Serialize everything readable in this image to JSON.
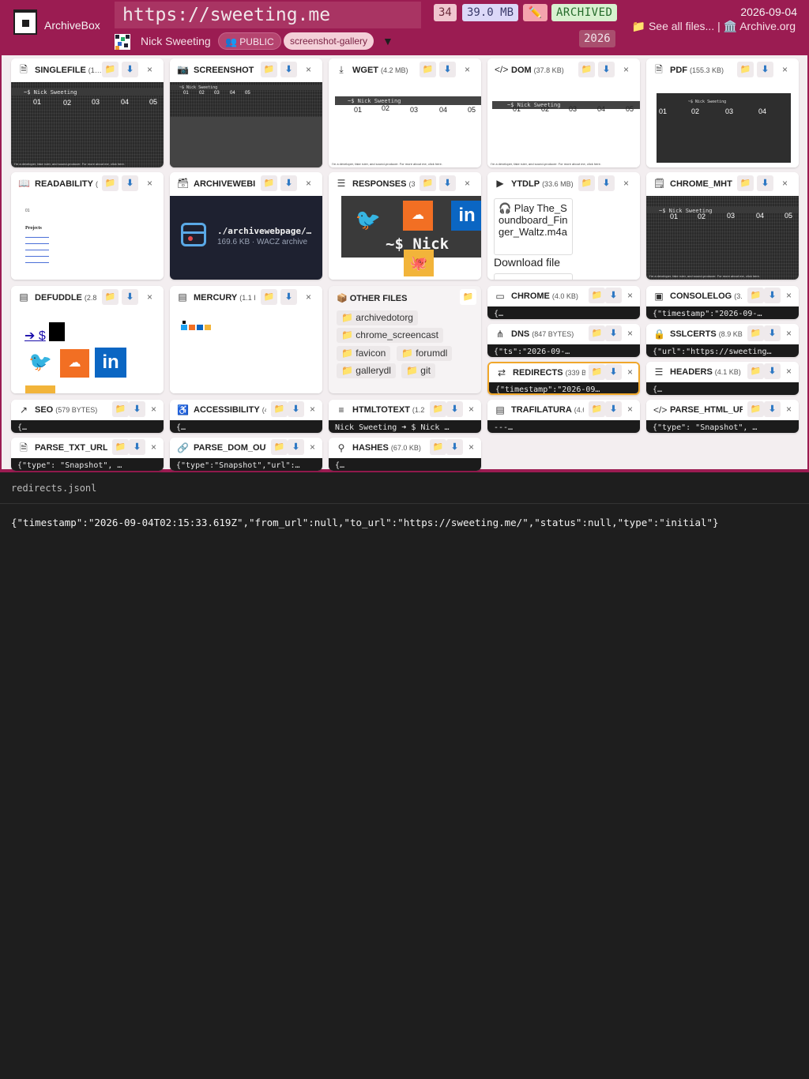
{
  "header": {
    "brand": "ArchiveBox",
    "url": "https://sweeting.me",
    "count": "34",
    "size": "39.0 MB",
    "edit_icon": "✏️",
    "status": "ARCHIVED",
    "year": "2026",
    "author": "Nick Sweeting",
    "visibility": "👥 PUBLIC",
    "tag": "screenshot-gallery",
    "tag_menu": "▼",
    "date": "2026-09-04",
    "see_all": "📁 See all files...",
    "separator": " | ",
    "archive_org": "🏛️ Archive.org",
    "colors": {
      "header_bg": "#9b1c52",
      "accent": "#f0a72a"
    }
  },
  "cards": {
    "singlefile": {
      "title": "SINGLEFILE",
      "size": "(1⁠…"
    },
    "screenshot": {
      "title": "SCREENSHOT"
    },
    "wget": {
      "title": "WGET",
      "size": "(4.2 MB)"
    },
    "dom": {
      "title": "DOM",
      "size": "(37.8 KB)"
    },
    "pdf": {
      "title": "PDF",
      "size": "(155.3 KB)"
    },
    "readability": {
      "title": "READABILITY",
      "size": "("
    },
    "archivewebpage": {
      "title": "ARCHIVEWEBI",
      "file": "./archivewebpage/…",
      "meta": "169.6 KB · WACZ archive"
    },
    "responses": {
      "title": "RESPONSES",
      "size": "(3"
    },
    "ytdlp": {
      "title": "YTDLP",
      "size": "(33.6 MB)",
      "play": "🎧 Play The_Soundboard_Finger_Waltz.m4a",
      "download": "Download file"
    },
    "chrome_mht": {
      "title": "CHROME_MHT"
    },
    "defuddle": {
      "title": "DEFUDDLE",
      "size": "(2.8"
    },
    "mercury": {
      "title": "MERCURY",
      "size": "(1.1 I"
    },
    "other_files": {
      "title": "📦 OTHER FILES",
      "files": [
        "📁 archivedotorg",
        "📁 chrome_screencast",
        "📁 favicon",
        "📁 forumdl",
        "📁 gallerydl",
        "📁 git"
      ]
    },
    "chrome": {
      "title": "CHROME",
      "size": "(4.0 KB)",
      "preview": "{…"
    },
    "consolelog": {
      "title": "CONSOLELOG",
      "size": "(3.",
      "preview": "{\"timestamp\":\"2026-09-…"
    },
    "dns": {
      "title": "DNS",
      "size": "(847 BYTES)",
      "preview": "{\"ts\":\"2026-09-…"
    },
    "sslcerts": {
      "title": "SSLCERTS",
      "size": "(8.9 KB)",
      "preview": "{\"url\":\"https://sweeting…"
    },
    "redirects": {
      "title": "REDIRECTS",
      "size": "(339 B",
      "preview": "{\"timestamp\":\"2026-09…"
    },
    "headers": {
      "title": "HEADERS",
      "size": "(4.1 KB)",
      "preview": "{…"
    },
    "seo": {
      "title": "SEO",
      "size": "(579 BYTES)",
      "preview": "{…"
    },
    "accessibility": {
      "title": "ACCESSIBILITY",
      "size": "(4",
      "preview": "{…"
    },
    "htmltotext": {
      "title": "HTMLTOTEXT",
      "size": "(1.2",
      "preview": "Nick Sweeting ➜ $ Nick …"
    },
    "trafilatura": {
      "title": "TRAFILATURA",
      "size": "(4.6",
      "preview": "---…"
    },
    "parse_html": {
      "title": "PARSE_HTML_UR",
      "preview": "{\"type\": \"Snapshot\", …"
    },
    "parse_txt": {
      "title": "PARSE_TXT_URLS",
      "preview": "{\"type\": \"Snapshot\", …"
    },
    "parse_dom": {
      "title": "PARSE_DOM_OUT",
      "preview": "{\"type\":\"Snapshot\",\"url\":…"
    },
    "hashes": {
      "title": "HASHES",
      "size": "(67.0 KB)",
      "preview": "{…"
    }
  },
  "thumb_text": {
    "prompt": "~$ Nick Sweeting",
    "nums": [
      "01",
      "02",
      "03",
      "04",
      "05"
    ],
    "footer": "I'm a developer, fake ruler, and sound-producer. For more about me, click here.",
    "projects": "Projects",
    "nick": "~$ Nick",
    "arrow": "➔ $ "
  },
  "preview": {
    "filename": "redirects.jsonl",
    "content": "{\"timestamp\":\"2026-09-04T02:15:33.619Z\",\"from_url\":null,\"to_url\":\"https://sweeting.me/\",\"status\":null,\"type\":\"initial\"}"
  }
}
